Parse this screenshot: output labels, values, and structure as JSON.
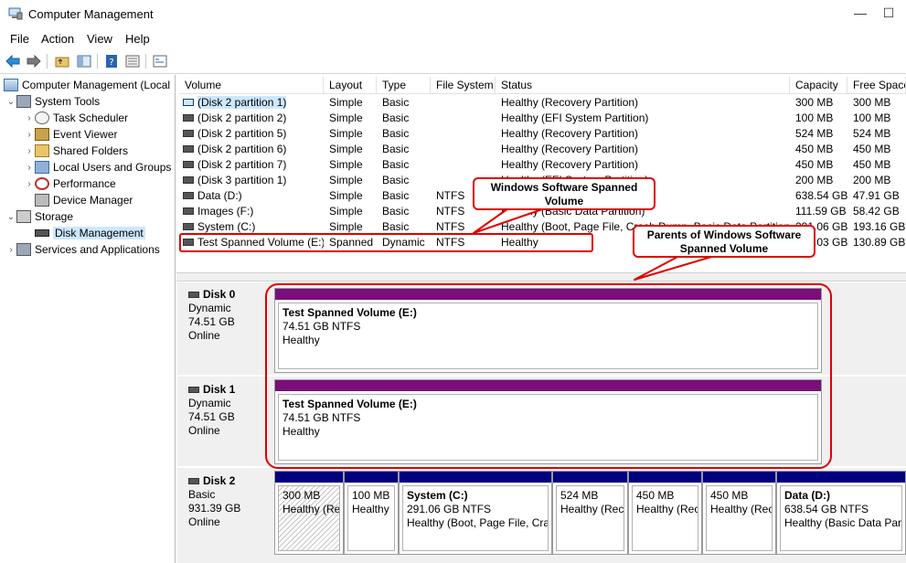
{
  "window": {
    "title": "Computer Management",
    "minimize": "—",
    "maximize": "☐"
  },
  "menu": [
    "File",
    "Action",
    "View",
    "Help"
  ],
  "tree": {
    "root": "Computer Management (Local",
    "system_tools": "System Tools",
    "task_scheduler": "Task Scheduler",
    "event_viewer": "Event Viewer",
    "shared_folders": "Shared Folders",
    "local_users": "Local Users and Groups",
    "performance": "Performance",
    "device_manager": "Device Manager",
    "storage": "Storage",
    "disk_management": "Disk Management",
    "services": "Services and Applications"
  },
  "columns": [
    "Volume",
    "Layout",
    "Type",
    "File System",
    "Status",
    "Capacity",
    "Free Space"
  ],
  "volumes": [
    {
      "name": "(Disk 2 partition 1)",
      "layout": "Simple",
      "type": "Basic",
      "fs": "",
      "status": "Healthy (Recovery Partition)",
      "capacity": "300 MB",
      "free": "300 MB"
    },
    {
      "name": "(Disk 2 partition 2)",
      "layout": "Simple",
      "type": "Basic",
      "fs": "",
      "status": "Healthy (EFI System Partition)",
      "capacity": "100 MB",
      "free": "100 MB"
    },
    {
      "name": "(Disk 2 partition 5)",
      "layout": "Simple",
      "type": "Basic",
      "fs": "",
      "status": "Healthy (Recovery Partition)",
      "capacity": "524 MB",
      "free": "524 MB"
    },
    {
      "name": "(Disk 2 partition 6)",
      "layout": "Simple",
      "type": "Basic",
      "fs": "",
      "status": "Healthy (Recovery Partition)",
      "capacity": "450 MB",
      "free": "450 MB"
    },
    {
      "name": "(Disk 2 partition 7)",
      "layout": "Simple",
      "type": "Basic",
      "fs": "",
      "status": "Healthy (Recovery Partition)",
      "capacity": "450 MB",
      "free": "450 MB"
    },
    {
      "name": "(Disk 3 partition 1)",
      "layout": "Simple",
      "type": "Basic",
      "fs": "",
      "status": "Healthy (EFI System Partition)",
      "capacity": "200 MB",
      "free": "200 MB"
    },
    {
      "name": "Data (D:)",
      "layout": "Simple",
      "type": "Basic",
      "fs": "NTFS",
      "status": "Healthy (Basic Data Partition)",
      "capacity": "638.54 GB",
      "free": "47.91 GB"
    },
    {
      "name": "Images (F:)",
      "layout": "Simple",
      "type": "Basic",
      "fs": "NTFS",
      "status": "Healthy (Basic Data Partition)",
      "capacity": "111.59 GB",
      "free": "58.42 GB"
    },
    {
      "name": "System (C:)",
      "layout": "Simple",
      "type": "Basic",
      "fs": "NTFS",
      "status": "Healthy (Boot, Page File, Crash Dump, Basic Data Partition)",
      "capacity": "291.06 GB",
      "free": "193.16 GB"
    },
    {
      "name": "Test Spanned Volume (E:)",
      "layout": "Spanned",
      "type": "Dynamic",
      "fs": "NTFS",
      "status": "Healthy",
      "capacity": "149.03 GB",
      "free": "130.89 GB"
    }
  ],
  "disks": [
    {
      "name": "Disk 0",
      "type": "Dynamic",
      "size": "74.51 GB",
      "state": "Online",
      "partition": {
        "name": "Test Spanned Volume  (E:)",
        "size": "74.51 GB NTFS",
        "status": "Healthy"
      }
    },
    {
      "name": "Disk 1",
      "type": "Dynamic",
      "size": "74.51 GB",
      "state": "Online",
      "partition": {
        "name": "Test Spanned Volume  (E:)",
        "size": "74.51 GB NTFS",
        "status": "Healthy"
      }
    },
    {
      "name": "Disk 2",
      "type": "Basic",
      "size": "931.39 GB",
      "state": "Online"
    }
  ],
  "disk2_partitions": [
    {
      "name": "",
      "size": "300 MB",
      "status": "Healthy (Re"
    },
    {
      "name": "",
      "size": "100 MB",
      "status": "Healthy"
    },
    {
      "name": "System  (C:)",
      "size": "291.06 GB NTFS",
      "status": "Healthy (Boot, Page File, Cras"
    },
    {
      "name": "",
      "size": "524 MB",
      "status": "Healthy (Rec"
    },
    {
      "name": "",
      "size": "450 MB",
      "status": "Healthy (Rec"
    },
    {
      "name": "",
      "size": "450 MB",
      "status": "Healthy (Rec"
    },
    {
      "name": "Data  (D:)",
      "size": "638.54 GB NTFS",
      "status": "Healthy (Basic Data Part"
    }
  ],
  "annotations": {
    "callout1": "Windows Software Spanned Volume",
    "callout2": "Parents of Windows Software Spanned Volume"
  },
  "colors": {
    "spanned_bar": "#7a0e7a",
    "basic_bar": "#00007f",
    "annotation": "#e00000",
    "selection": "#cce8ff"
  }
}
